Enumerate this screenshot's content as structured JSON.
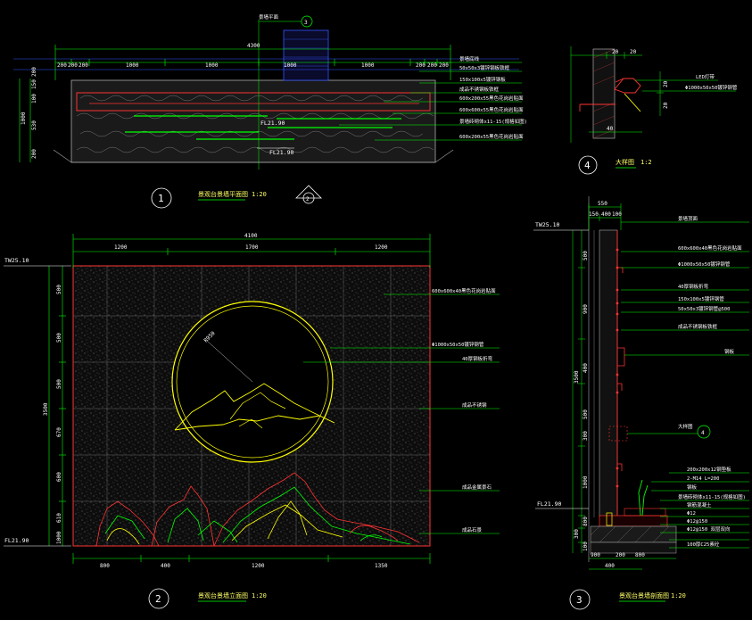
{
  "colors": {
    "background": "#000000",
    "dimension": "#00ff00",
    "text": "#ffffff",
    "title": "#ffff66",
    "wall_edge": "#ff3333",
    "detail": "#ffff00",
    "structure": "#3355ff",
    "leader": "#00ff00",
    "plant": "#ff3333",
    "plant_alt": "#00ff00",
    "plant_alt2": "#ffff00"
  },
  "plan": {
    "title": "景观台景墙平面图",
    "scale": "1:20",
    "number": "1",
    "overall_width": "4300",
    "top_ref_label": "景墙平面",
    "top_ref_number": "3",
    "dims_top": [
      "200",
      "200",
      "200",
      "1000",
      "1000",
      "1000",
      "1000",
      "200",
      "200",
      "200"
    ],
    "dims_left": [
      "200",
      "150",
      "100",
      "530",
      "1000",
      "200"
    ],
    "level_center": "FL21.90",
    "level_bottom": "FL21.90",
    "notes": [
      "景墙底线",
      "50x50x3镀锌钢板铁框",
      "150x100x5镀锌钢板",
      "成品不锈钢板铁框",
      "600x200x55黑色花岗岩贴面",
      "600x600x55黑色花岗岩贴面",
      "景墙砖砌体x11-15(规格如图)",
      "600x200x55黑色花岗岩贴面"
    ],
    "arrow_number": "2"
  },
  "detail": {
    "title": "大样图",
    "scale": "1:2",
    "number": "4",
    "dims_top": [
      "20",
      "20"
    ],
    "dims_right": [
      "20",
      "20"
    ],
    "dim_bottom": "40",
    "note_led": "LED灯带",
    "note_frame": "Φ1000x50x50镀锌钢管"
  },
  "elevation": {
    "title": "景观台景墙立面图",
    "scale": "1:20",
    "number": "2",
    "overall_width": "4100",
    "dims_top": [
      "1200",
      "1700",
      "1200"
    ],
    "dims_left": [
      "500",
      "500",
      "500",
      "670",
      "600",
      "610",
      "1000"
    ],
    "total_height": "3500",
    "dims_bottom": [
      "800",
      "400",
      "1200",
      "1350"
    ],
    "level_top": "TW25.10",
    "level_bottom": "FL21.90",
    "notes": [
      "600x600x40黑色花岗岩贴面",
      "Φ1000x50x50镀锌钢管",
      "40厚钢板折弯",
      "成品不锈钢",
      "成品金属景石",
      "成品石景"
    ],
    "ring_label": "R950"
  },
  "section": {
    "title": "景观台景墙剖面图",
    "scale": "1:20",
    "number": "3",
    "top_dims": [
      "550",
      "150",
      "400",
      "100"
    ],
    "dims_left": [
      "500",
      "900",
      "400",
      "500",
      "3500",
      "300",
      "1000",
      "800",
      "300",
      "100"
    ],
    "dims_bottom": [
      "900",
      "200",
      "800"
    ],
    "dim_bottom_total": "400",
    "level_top": "TW25.10",
    "level_bottom": "FL21.90",
    "notes": [
      "景墙顶面",
      "600x600x40黑色花岗岩贴面",
      "Φ1000x50x50镀锌钢管",
      "40厚钢板折弯",
      "150x100x5镀锌钢管",
      "50x50x3镀锌钢管@500",
      "成品不锈钢板铁框",
      "钢板",
      "大样图",
      "200x200x12钢垫板",
      "2-M14 L=200",
      "钢板",
      "景墙砖砌体x11-15(规格如图)",
      "钢筋混凝土",
      "Φ12",
      "Φ12@150",
      "Φ12@150 双层双向",
      "100厚C25素砼"
    ],
    "detail_callout": "4"
  }
}
